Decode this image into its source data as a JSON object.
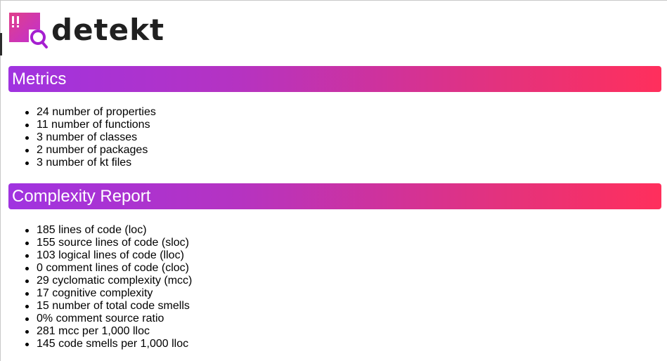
{
  "brand": {
    "name": "detekt",
    "logo_icon": "detekt-logo-icon",
    "colors": {
      "gradient_start": "#a033e0",
      "gradient_end": "#ff2f5c",
      "logo_square": "#d63bb0",
      "logo_magnifier": "#a51fd0"
    }
  },
  "sections": [
    {
      "title": "Metrics",
      "items": [
        "24 number of properties",
        "11 number of functions",
        "3 number of classes",
        "2 number of packages",
        "3 number of kt files"
      ]
    },
    {
      "title": "Complexity Report",
      "items": [
        "185 lines of code (loc)",
        "155 source lines of code (sloc)",
        "103 logical lines of code (lloc)",
        "0 comment lines of code (cloc)",
        "29 cyclomatic complexity (mcc)",
        "17 cognitive complexity",
        "15 number of total code smells",
        "0% comment source ratio",
        "281 mcc per 1,000 lloc",
        "145 code smells per 1,000 lloc"
      ]
    }
  ]
}
